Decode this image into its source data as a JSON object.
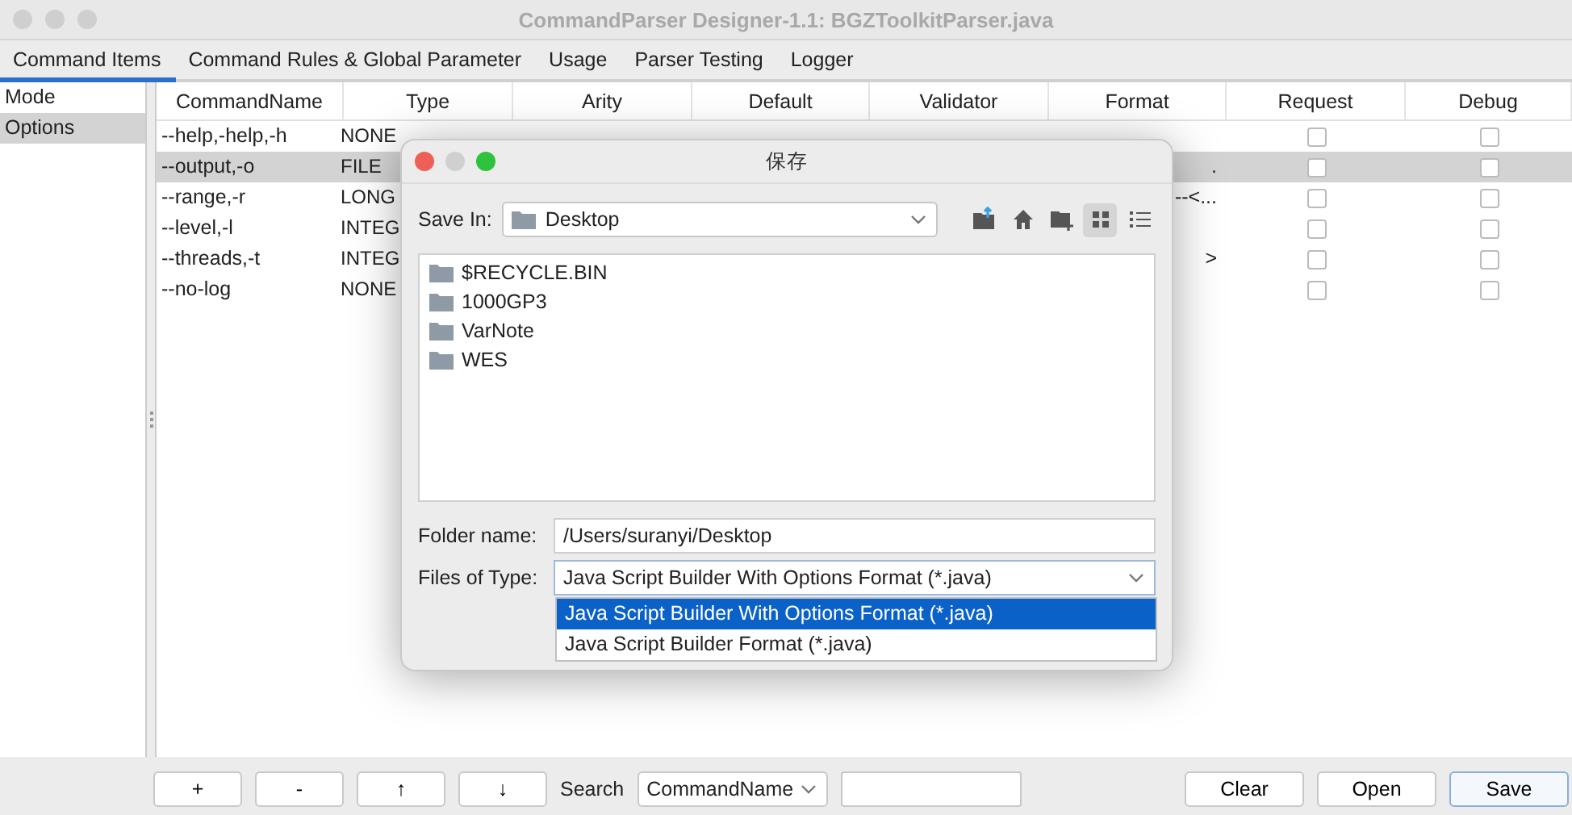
{
  "window": {
    "title": "CommandParser Designer-1.1: BGZToolkitParser.java"
  },
  "tabs": [
    {
      "label": "Command Items",
      "selected": true
    },
    {
      "label": "Command Rules & Global Parameter",
      "selected": false
    },
    {
      "label": "Usage",
      "selected": false
    },
    {
      "label": "Parser Testing",
      "selected": false
    },
    {
      "label": "Logger",
      "selected": false
    }
  ],
  "sidebar": {
    "items": [
      {
        "label": "Mode",
        "selected": false
      },
      {
        "label": "Options",
        "selected": true
      }
    ]
  },
  "table": {
    "columns": [
      "CommandName",
      "Type",
      "Arity",
      "Default",
      "Validator",
      "Format",
      "Request",
      "Debug"
    ],
    "rows": [
      {
        "command_name": "--help,-help,-h",
        "type": "NONE",
        "format": "",
        "request": false,
        "debug": false,
        "selected": false
      },
      {
        "command_name": "--output,-o",
        "type": "FILE",
        "format": ".",
        "request": false,
        "debug": false,
        "selected": true
      },
      {
        "command_name": "--range,-r",
        "type": "LONG",
        "format": "--<...",
        "request": false,
        "debug": false,
        "selected": false
      },
      {
        "command_name": "--level,-l",
        "type": "INTEG",
        "format": "",
        "request": false,
        "debug": false,
        "selected": false
      },
      {
        "command_name": "--threads,-t",
        "type": "INTEG",
        "format": ">",
        "request": false,
        "debug": false,
        "selected": false
      },
      {
        "command_name": "--no-log",
        "type": "NONE",
        "format": "",
        "request": false,
        "debug": false,
        "selected": false
      }
    ]
  },
  "bottom_bar": {
    "buttons_left": [
      "+",
      "-",
      "↑",
      "↓"
    ],
    "search_label": "Search",
    "search_field": {
      "value": "CommandName"
    },
    "buttons_right": [
      {
        "label": "Clear",
        "default": false
      },
      {
        "label": "Open",
        "default": false
      },
      {
        "label": "Save",
        "default": true
      }
    ]
  },
  "dialog": {
    "title": "保存",
    "save_in_label": "Save In:",
    "save_in_value": "Desktop",
    "toolbar": [
      {
        "kind": "up",
        "selected": false
      },
      {
        "kind": "home",
        "selected": false
      },
      {
        "kind": "new-folder",
        "selected": false
      },
      {
        "kind": "grid",
        "selected": true
      },
      {
        "kind": "list",
        "selected": false
      }
    ],
    "files": [
      "$RECYCLE.BIN",
      "1000GP3",
      "VarNote",
      "WES"
    ],
    "folder_name_label": "Folder name:",
    "folder_name_value": "/Users/suranyi/Desktop",
    "file_type_label": "Files of Type:",
    "file_type_value": "Java Script Builder With Options Format (*.java)",
    "file_type_options": [
      {
        "label": "Java Script Builder With Options Format (*.java)",
        "selected": true
      },
      {
        "label": "Java Script Builder Format (*.java)",
        "selected": false
      }
    ]
  }
}
